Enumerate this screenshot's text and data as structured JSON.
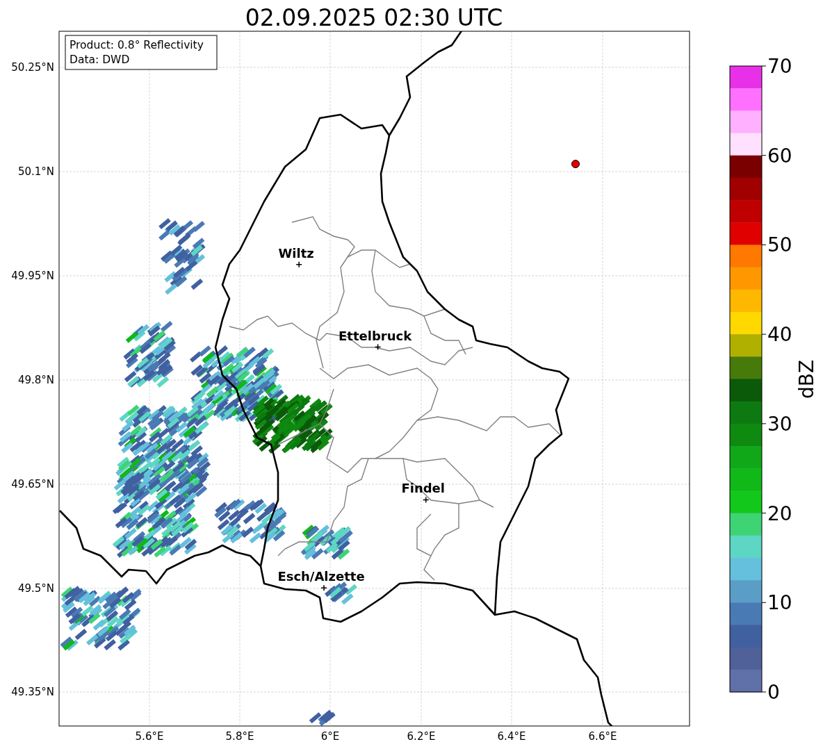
{
  "title": "02.09.2025 02:30 UTC",
  "info_box": [
    "Product: 0.8° Reflectivity",
    "Data: DWD"
  ],
  "x_ticks": [
    "5.6°E",
    "5.8°E",
    "6°E",
    "6.2°E",
    "6.4°E",
    "6.6°E"
  ],
  "y_ticks": [
    "50.25°N",
    "50.1°N",
    "49.95°N",
    "49.8°N",
    "49.65°N",
    "49.5°N",
    "49.35°N"
  ],
  "cities": [
    {
      "name": "Wiltz"
    },
    {
      "name": "Ettelbruck"
    },
    {
      "name": "Findel"
    },
    {
      "name": "Esch/Alzette"
    }
  ],
  "radar_site": {
    "color": "#e00000"
  },
  "colorbar": {
    "label": "dBZ",
    "ticks": [
      "70",
      "60",
      "50",
      "40",
      "30",
      "20",
      "10",
      "0"
    ],
    "segments": [
      {
        "color": "#e830e8"
      },
      {
        "color": "#ff70ff"
      },
      {
        "color": "#ffb0ff"
      },
      {
        "color": "#ffe0ff"
      },
      {
        "color": "#7a0000"
      },
      {
        "color": "#a00000"
      },
      {
        "color": "#c00000"
      },
      {
        "color": "#e00000"
      },
      {
        "color": "#ff7800"
      },
      {
        "color": "#ff9800"
      },
      {
        "color": "#ffb800"
      },
      {
        "color": "#ffd800"
      },
      {
        "color": "#b0b000"
      },
      {
        "color": "#467a0a"
      },
      {
        "color": "#0a5a0a"
      },
      {
        "color": "#0c7a10"
      },
      {
        "color": "#0e8a10"
      },
      {
        "color": "#10a818"
      },
      {
        "color": "#10b818"
      },
      {
        "color": "#12c81a"
      },
      {
        "color": "#3ed474"
      },
      {
        "color": "#5ed6c4"
      },
      {
        "color": "#64c0dc"
      },
      {
        "color": "#5a9ec8"
      },
      {
        "color": "#4a7ab4"
      },
      {
        "color": "#4060a0"
      },
      {
        "color": "#506098"
      },
      {
        "color": "#6070a8"
      }
    ]
  }
}
